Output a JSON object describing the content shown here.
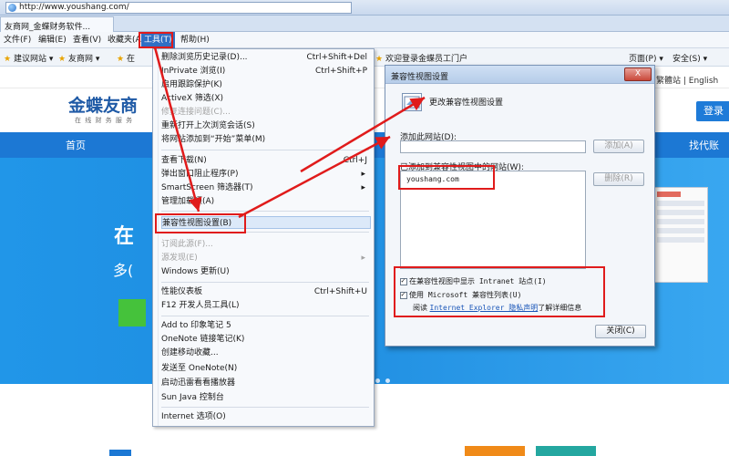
{
  "browser": {
    "url": "http://www.youshang.com/",
    "tab_title": "友商网_金蝶财务软件...",
    "menu": {
      "file": "文件(F)",
      "edit": "编辑(E)",
      "view": "查看(V)",
      "favorites": "收藏夹(A)",
      "tools": "工具(T)",
      "help": "帮助(H)"
    },
    "favbar": {
      "suggested": "建议网站",
      "youshang": "友商网",
      "partial": "在",
      "welcome": "欢迎登录金蝶员工门户",
      "page": "页面(P)",
      "safety": "安全(S)"
    }
  },
  "page": {
    "logo": "金蝶友商",
    "slogan": "在 线 财 务 服 务",
    "right_links": "繁體站  |  English",
    "login": "登录",
    "nav_home": "首页",
    "nav_find": "找代账",
    "banner_big": "在",
    "banner_sub": "多(",
    "accent": "#1c78d4"
  },
  "tools_menu": {
    "items": [
      {
        "label": "删除浏览历史记录(D)...",
        "shortcut": "Ctrl+Shift+Del"
      },
      {
        "label": "InPrivate 浏览(I)",
        "shortcut": "Ctrl+Shift+P"
      },
      {
        "label": "启用跟踪保护(K)"
      },
      {
        "label": "ActiveX 筛选(X)"
      },
      {
        "label": "修复连接问题(C)..."
      },
      {
        "label": "重新打开上次浏览会话(S)"
      },
      {
        "label": "将网站添加到“开始”菜单(M)"
      },
      {
        "label": "查看下载(N)",
        "shortcut": "Ctrl+J"
      },
      {
        "label": "弹出窗口阻止程序(P)"
      },
      {
        "label": "SmartScreen 筛选器(T)"
      },
      {
        "label": "管理加载项(A)"
      },
      {
        "label": "兼容性视图设置(B)"
      },
      {
        "label": "订阅此源(F)..."
      },
      {
        "label": "源发现(E)"
      },
      {
        "label": "Windows 更新(U)"
      },
      {
        "label": "性能仪表板",
        "shortcut": "Ctrl+Shift+U"
      },
      {
        "label": "F12 开发人员工具(L)"
      },
      {
        "label": "Add to 印象笔记 5"
      },
      {
        "label": "OneNote 链接笔记(K)"
      },
      {
        "label": "创建移动收藏..."
      },
      {
        "label": "发送至 OneNote(N)"
      },
      {
        "label": "启动迅雷看看播放器"
      },
      {
        "label": "Sun Java 控制台"
      },
      {
        "label": "Internet 选项(O)"
      }
    ]
  },
  "dialog": {
    "title": "兼容性视图设置",
    "close": "X",
    "heading": "更改兼容性视图设置",
    "add_label": "添加此网站(D):",
    "add_button": "添加(A)",
    "list_label": "已添加到兼容性视图中的网站(W):",
    "remove_button": "删除(R)",
    "sites": [
      "youshang.com"
    ],
    "check_intranet": "在兼容性视图中显示 Intranet 站点(I)",
    "check_msft": "使用 Microsoft 兼容性列表(U)",
    "learn_prefix": "阅读 ",
    "learn_link": "Internet Explorer 隐私声明",
    "learn_suffix": "了解详细信息",
    "close_button": "关闭(C)"
  }
}
